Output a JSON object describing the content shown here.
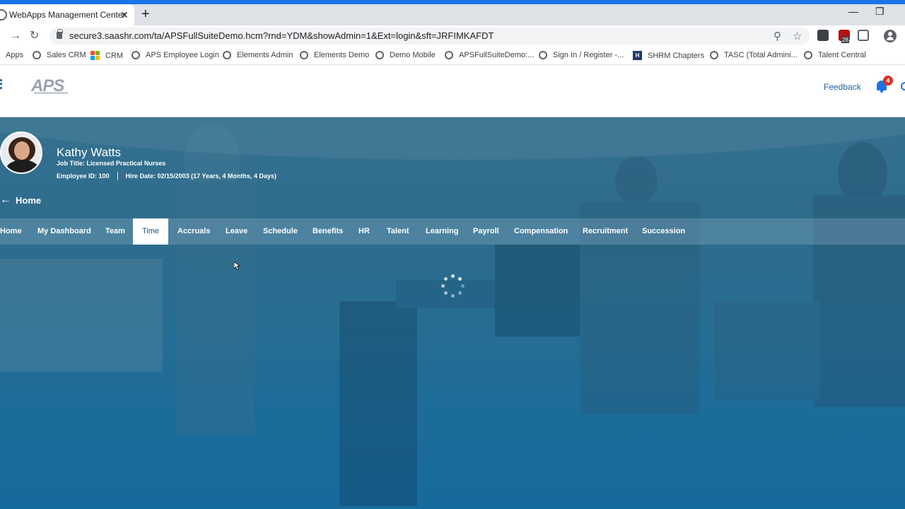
{
  "browser": {
    "tab_title": "WebApps Management Center",
    "tab_close": "✕",
    "new_tab": "+",
    "url": "secure3.saashr.com/ta/APSFullSuiteDemo.hcm?rnd=YDM&showAdmin=1&Ext=login&sft=JRFIMKAFDT",
    "extension_badge": "28",
    "bookmarks": [
      {
        "label": "Apps",
        "icon": "apps-icon"
      },
      {
        "label": "Sales CRM",
        "icon": "globe-icon"
      },
      {
        "label": "CRM",
        "icon": "microsoft-icon"
      },
      {
        "label": "APS Employee Login",
        "icon": "globe-icon"
      },
      {
        "label": "Elements Admin",
        "icon": "globe-icon"
      },
      {
        "label": "Elements Demo",
        "icon": "globe-icon"
      },
      {
        "label": "Demo Mobile",
        "icon": "globe-icon"
      },
      {
        "label": "APSFullSuiteDemo:...",
        "icon": "globe-icon"
      },
      {
        "label": "Sign In / Register -...",
        "icon": "globe-icon"
      },
      {
        "label": "SHRM Chapters",
        "icon": "shrm-icon"
      },
      {
        "label": "TASC (Total Admini...",
        "icon": "tasc-icon"
      },
      {
        "label": "Talent Central",
        "icon": "globe-icon"
      }
    ]
  },
  "app": {
    "logo_text": "APS",
    "feedback": "Feedback",
    "notification_count": "4"
  },
  "employee": {
    "name": "Kathy Watts",
    "job_title": "Job Title: Licensed Practical Nurses",
    "employee_id": "Employee ID: 100",
    "hire_date": "Hire Date: 02/15/2003 (17 Years, 4 Months, 4 Days)"
  },
  "back_link": "Home",
  "menu": [
    {
      "label": "Home",
      "active": false
    },
    {
      "label": "My Dashboard",
      "active": false
    },
    {
      "label": "Team",
      "active": false
    },
    {
      "label": "Time",
      "active": true
    },
    {
      "label": "Accruals",
      "active": false
    },
    {
      "label": "Leave",
      "active": false
    },
    {
      "label": "Schedule",
      "active": false
    },
    {
      "label": "Benefits",
      "active": false
    },
    {
      "label": "HR",
      "active": false
    },
    {
      "label": "Talent",
      "active": false
    },
    {
      "label": "Learning",
      "active": false
    },
    {
      "label": "Payroll",
      "active": false
    },
    {
      "label": "Compensation",
      "active": false
    },
    {
      "label": "Recruitment",
      "active": false
    },
    {
      "label": "Succession",
      "active": false
    }
  ],
  "colors": {
    "browser_accent": "#1a73e8",
    "hero_blue": "#176a9d",
    "link_blue": "#1a5d9c",
    "badge_red": "#d93025"
  }
}
